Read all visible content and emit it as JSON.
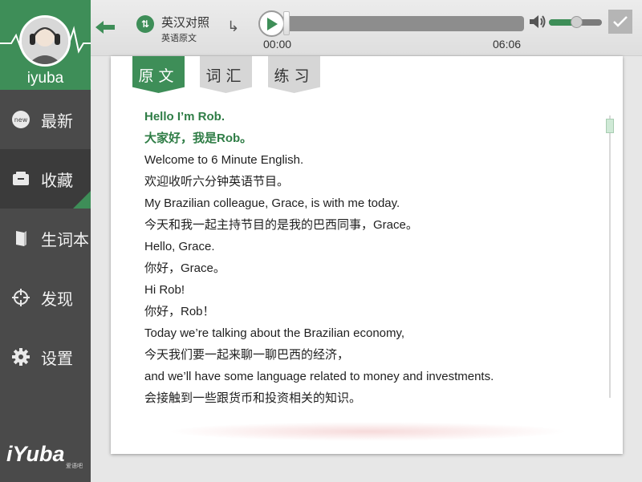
{
  "sidebar": {
    "username": "iyuba",
    "items": [
      {
        "label": "最新",
        "icon": "new-badge-icon"
      },
      {
        "label": "收藏",
        "icon": "folder-icon"
      },
      {
        "label": "生词本",
        "icon": "book-icon"
      },
      {
        "label": "发现",
        "icon": "crosshair-icon"
      },
      {
        "label": "设置",
        "icon": "gear-icon"
      }
    ],
    "active_index": 1,
    "brand": "iYuba",
    "brand_sub": "爱语吧"
  },
  "player": {
    "mode_title": "英汉对照",
    "mode_sub": "英语原文",
    "time_current": "00:00",
    "time_total": "06:06",
    "progress": 0.0,
    "volume": 0.45
  },
  "tabs": [
    "原文",
    "词汇",
    "练习"
  ],
  "active_tab": 0,
  "transcript": [
    {
      "text": "Hello I’m Rob.",
      "highlight": true
    },
    {
      "text": "大家好，我是Rob。",
      "highlight": true
    },
    {
      "text": "Welcome to 6 Minute English.",
      "highlight": false
    },
    {
      "text": "欢迎收听六分钟英语节目。",
      "highlight": false
    },
    {
      "text": "My Brazilian colleague, Grace, is with me today.",
      "highlight": false
    },
    {
      "text": "今天和我一起主持节目的是我的巴西同事，Grace。",
      "highlight": false
    },
    {
      "text": "Hello, Grace.",
      "highlight": false
    },
    {
      "text": "你好，Grace。",
      "highlight": false
    },
    {
      "text": "Hi Rob!",
      "highlight": false
    },
    {
      "text": "你好，Rob！",
      "highlight": false
    },
    {
      "text": "Today we’re talking about the Brazilian economy,",
      "highlight": false
    },
    {
      "text": "今天我们要一起来聊一聊巴西的经济，",
      "highlight": false
    },
    {
      "text": "and we’ll have some language related to money and investments.",
      "highlight": false
    },
    {
      "text": "会接触到一些跟货币和投资相关的知识。",
      "highlight": false
    }
  ],
  "colors": {
    "accent": "#3e8e58",
    "sidebar_bg": "#4a4a4a",
    "highlight_text": "#2f7d46"
  }
}
